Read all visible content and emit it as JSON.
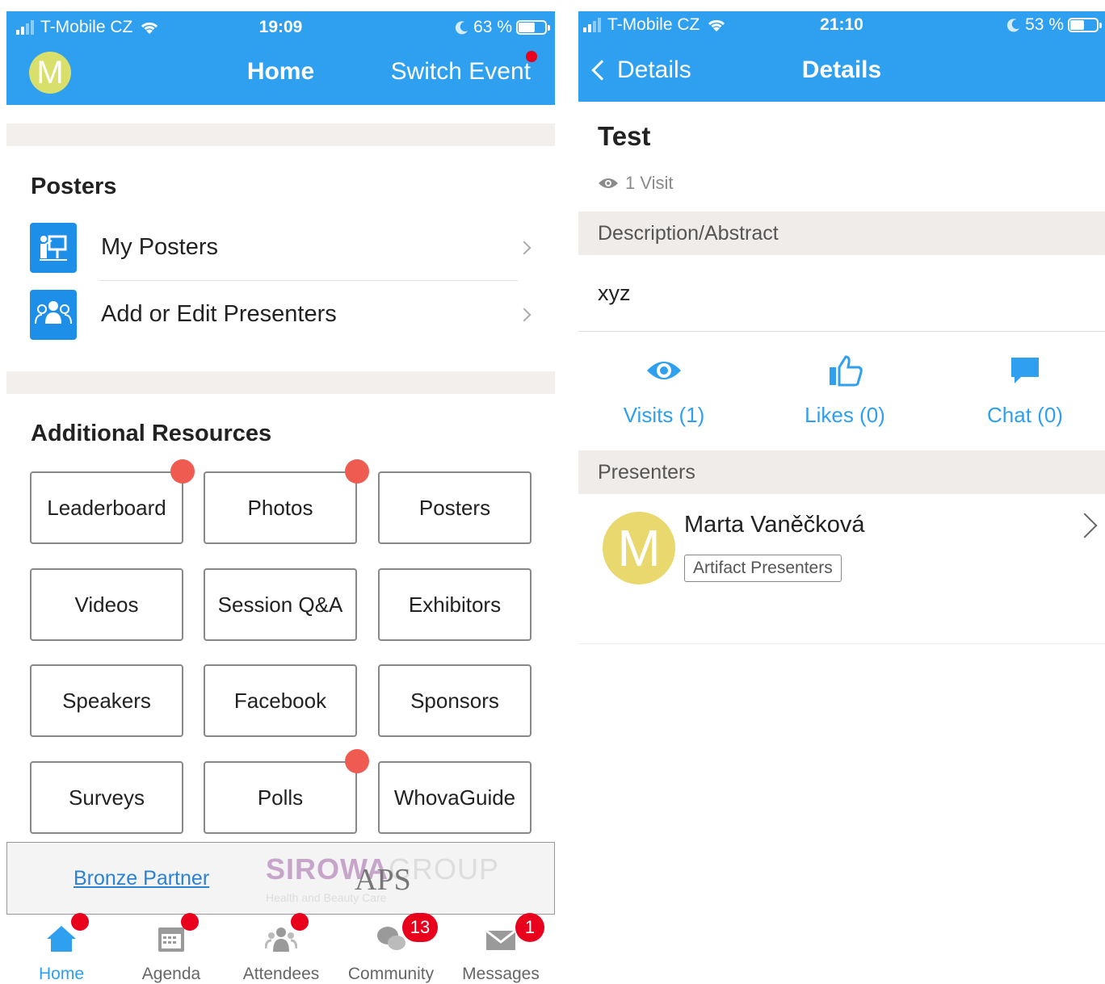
{
  "left": {
    "status": {
      "carrier": "T-Mobile CZ",
      "time": "19:09",
      "battery": "63 %",
      "battery_level": 0.63
    },
    "nav": {
      "avatar_letter": "M",
      "title": "Home",
      "switch_label": "Switch Event"
    },
    "posters_section": {
      "title": "Posters",
      "items": [
        {
          "label": "My Posters"
        },
        {
          "label": "Add or Edit Presenters"
        }
      ]
    },
    "resources_section": {
      "title": "Additional Resources",
      "tiles": [
        "Leaderboard",
        "Photos",
        "Posters",
        "Videos",
        "Session Q&A",
        "Exhibitors",
        "Speakers",
        "Facebook",
        "Sponsors",
        "Surveys",
        "Polls",
        "WhovaGuide"
      ]
    },
    "partner": {
      "link": "Bronze Partner",
      "logo_main": "SIROWA",
      "logo_group": "GROUP",
      "logo_aps": "APS",
      "logo_sub": "Health and Beauty Care"
    },
    "tabs": [
      {
        "label": "Home",
        "icon": "home-icon"
      },
      {
        "label": "Agenda",
        "icon": "calendar-icon"
      },
      {
        "label": "Attendees",
        "icon": "people-icon"
      },
      {
        "label": "Community",
        "icon": "chat-bubbles-icon",
        "badge": "13"
      },
      {
        "label": "Messages",
        "icon": "envelope-icon",
        "badge": "1"
      }
    ],
    "accent": "#2f9ff0"
  },
  "right": {
    "status": {
      "carrier": "T-Mobile CZ",
      "time": "21:10",
      "battery": "53 %",
      "battery_level": 0.53
    },
    "nav": {
      "back_label": "Details",
      "title": "Details"
    },
    "poster": {
      "title": "Test",
      "visits": "1 Visit",
      "desc_header": "Description/Abstract",
      "description": "xyz"
    },
    "actions": [
      {
        "label": "Visits (1)",
        "icon": "eye-icon"
      },
      {
        "label": "Likes (0)",
        "icon": "thumbs-up-icon"
      },
      {
        "label": "Chat (0)",
        "icon": "chat-icon"
      }
    ],
    "presenters": {
      "header": "Presenters",
      "items": [
        {
          "avatar_letter": "M",
          "name": "Marta Vaněčková",
          "tag": "Artifact Presenters"
        }
      ]
    }
  }
}
